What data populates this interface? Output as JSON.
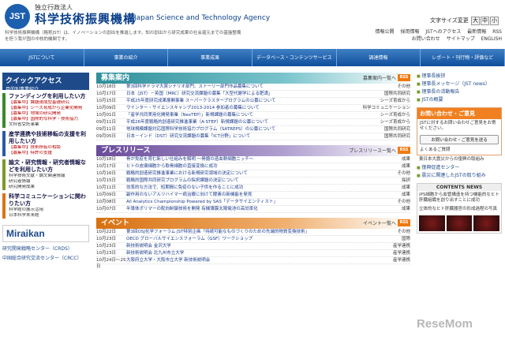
{
  "header": {
    "logo": "JST",
    "org": "独立行政法人",
    "title_jp": "科学技術振興機構",
    "title_en": "Japan Science and Technology Agency",
    "tagline": "科学技術振興機構（略称JST）は、イノベーションの創出を推進します。知の創出から研究成果の社会還元までの基盤整備を担う我が国の中核的機関です。",
    "fontsize_label": "文字サイズ変更",
    "fontsize_options": [
      "大",
      "中",
      "小"
    ],
    "utility": [
      "情報公開",
      "採用情報",
      "JSTへのアクセス",
      "最新情報",
      "RSS",
      "お問い合わせ",
      "サイトマップ",
      "ENGLISH"
    ]
  },
  "nav": [
    "JSTについて",
    "事業の紹介",
    "事業成果",
    "データベース・コンテンツサービス",
    "調達情報",
    "レポート・刊行物・評価など"
  ],
  "quick": {
    "title": "クイックアクセス",
    "sub": "目的別事業紹介",
    "sections": [
      {
        "head": "ファンディングを利用したい方",
        "items": [
          "【募集中】課題達成型基礎研究",
          "【募集中】シーズ育成から企業化開発",
          "【募集中】地域の研究開発",
          "【募集中】国際的な科学・技術協力",
          "文科省受託事業"
        ]
      },
      {
        "head": "産学連携や技術移転の支援を利用したい方",
        "items": [
          "【募集中】技術移転の相談",
          "【募集中】特許の支援"
        ]
      },
      {
        "head": "論文・研究情報・研究者情報などを利用したい方",
        "items": [
          "科学技術文献・論文関連情報",
          "研究者情報",
          "研究開発成果"
        ]
      },
      {
        "head": "科学コミュニケーションに関わりたい方",
        "items": [
          "科学館の展示活用",
          "日本科学未来館"
        ]
      }
    ],
    "miraikan": "Miraikan",
    "links": [
      "研究開発戦略センター（CRDS）",
      "中国総合研究交流センター（CRCC）"
    ]
  },
  "recruit": {
    "title": "募集案内",
    "more": "募集案内一覧へ",
    "rss": "RSS",
    "rows": [
      [
        "10月18日",
        "第3回科学ドラマ大賞シナリオ部門、ストーリー部門作品募集について",
        "その他"
      ],
      [
        "10月17日",
        "日本（JST）－英国（MRC）研究交流課題の募集「大型代謝学による肥満」",
        "国際共同研究"
      ],
      [
        "10月15日",
        "平成25年度研究成果展開事業 スーパークラスタープログラムの公募について",
        "シーズ育成から"
      ],
      [
        "10月09日",
        "ウインター・サイエンスキャンプ2013-2014 参加者の募集について",
        "科学コミュニケーション"
      ],
      [
        "10月01日",
        "「産学共同実用化開発事業（NexTEP）」新規課題の募集について",
        "シーズ育成から"
      ],
      [
        "09月11日",
        "平成26年度戦略的創造研究推進事業（A-STEP）新規課題の公募について",
        "シーズ育成から"
      ],
      [
        "09月11日",
        "地球規模課題対応国際科学技術協力プログラム（SATREPS）の公募について",
        "国際共同研究"
      ],
      [
        "09月05日",
        "日本－インド（DST）研究交流課題の募集「ICT分野」について",
        "国際共同研究"
      ]
    ]
  },
  "press": {
    "title": "プレスリリース",
    "more": "プレスリリース一覧へ",
    "rss": "RSS",
    "rows": [
      [
        "10月18日",
        "骨が免疫を育む新しい仕組みを解明 ～骨髄の造血幹細胞ニッチ～",
        "成果"
      ],
      [
        "10月17日",
        "ヒトの皮膚細胞から軟骨細胞の直接変換に成功",
        "成果"
      ],
      [
        "10月16日",
        "戦略的創造研究推進事業における新規研究領域の決定について",
        "その他"
      ],
      [
        "10月15日",
        "戦略的国際共同研究プログラムの採択課題の決定について",
        "採択"
      ],
      [
        "10月11日",
        "効率的な方法で、短期間に免疫のない子供を作ることに成功",
        "成果"
      ],
      [
        "10月09日",
        "副作用のないアルツハイマー病治療に向けて酵素の新機能を発見",
        "成果"
      ],
      [
        "10月08日",
        "All Analytics Championship Powered by SAS「データサイエンティスト」",
        "その他"
      ],
      [
        "10月07日",
        "半導体ポリマーの配向制御技術を開発 有機薄膜太陽電池の高効率化",
        "成果"
      ]
    ]
  },
  "events": {
    "title": "イベント",
    "more": "イベント一覧へ",
    "rss": "RSS",
    "rows": [
      [
        "10月22日",
        "第3回OSJ化学フォーラム JST特別企画「持続可能なものづくりのための先端的物質変換技術」",
        "その他"
      ],
      [
        "10月23日",
        "OECD グローバルサイエンスフォーラム（GSF）ワークショップ",
        "国際"
      ],
      [
        "10月23日",
        "新技術説明会 金沢大学",
        "産学連携"
      ],
      [
        "10月23日",
        "新技術説明会 北九州市立大学",
        "産学連携"
      ],
      [
        "10月24日〜25日",
        "大阪府立大学・大阪市立大学 新技術説明会",
        "産学連携"
      ]
    ]
  },
  "side": {
    "links": [
      "理事長挨拶",
      "理事長メッセージ（JST news）",
      "理事長の活動報告",
      "JSTの概要"
    ],
    "contact_title": "お問い合わせ・ご意見",
    "contact_text": "JSTに対するお問い合わせご意見をお寄せください。",
    "contact_button": "お問い合わせ・ご意見を送る",
    "faq": "よくあるご質問",
    "note": "東日本大震災からの復興の取組み",
    "note_links": [
      "復興促進センター",
      "震災に関連したJSTの取り組み"
    ],
    "news_title": "CONTENTS NEWS",
    "news_text": "iPS細胞から血管構造を持つ機能的なヒト肝臓組織を創り出すことに成功",
    "news_caption": "立体的なヒト肝臓器官の形成過程の写真",
    "watermark": "ReseMom"
  }
}
